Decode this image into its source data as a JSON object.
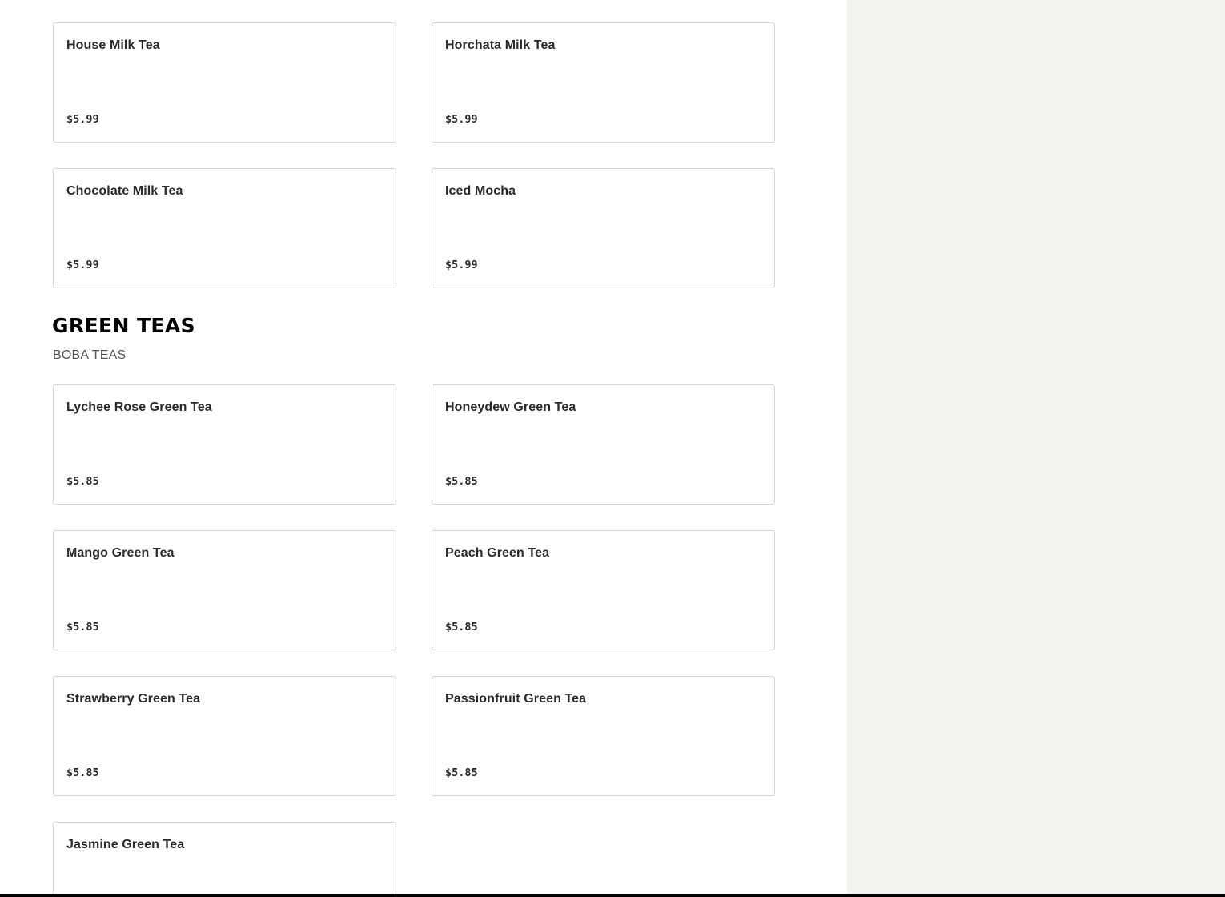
{
  "colors": {
    "main_background": "#ffffff",
    "side_panel_background": "#f3f2ef",
    "card_border": "#d6d6d6",
    "heading": "#000000",
    "subtitle": "#555555",
    "bottom_bar": "#000000"
  },
  "previous_section": {
    "items": [
      {
        "name": "House Milk Tea",
        "price": "$5.99"
      },
      {
        "name": "Horchata Milk Tea",
        "price": "$5.99"
      },
      {
        "name": "Chocolate Milk Tea",
        "price": "$5.99"
      },
      {
        "name": "Iced Mocha",
        "price": "$5.99"
      }
    ]
  },
  "green_teas": {
    "title": "GREEN TEAS",
    "subtitle": "BOBA TEAS",
    "items": [
      {
        "name": "Lychee Rose Green Tea",
        "price": "$5.85"
      },
      {
        "name": "Honeydew Green Tea",
        "price": "$5.85"
      },
      {
        "name": "Mango Green Tea",
        "price": "$5.85"
      },
      {
        "name": "Peach Green Tea",
        "price": "$5.85"
      },
      {
        "name": "Strawberry Green Tea",
        "price": "$5.85"
      },
      {
        "name": "Passionfruit Green Tea",
        "price": "$5.85"
      },
      {
        "name": "Jasmine Green Tea",
        "price": ""
      }
    ]
  }
}
